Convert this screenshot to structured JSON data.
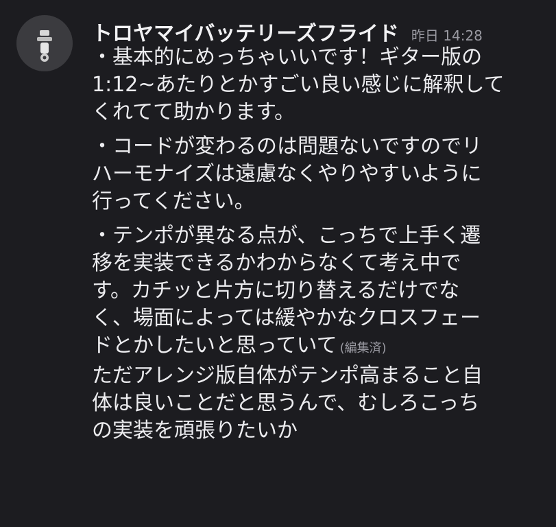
{
  "message": {
    "author": "トロヤマイバッテリーズフライド",
    "timestamp": "昨日 14:28",
    "edited_label": "(編集済)",
    "paragraphs": [
      {
        "lines": [
          "・基本的にめっちゃいいです！ギター版の",
          "1:12~あたりとかすごい良い感じに解釈して",
          "くれてて助かります。"
        ]
      },
      {
        "lines": [
          "・コードが変わるのは問題ないですのでリ",
          "ハーモナイズは遠慮なくやりやすいように",
          "行ってください。"
        ]
      },
      {
        "lines": [
          "・テンポが異なる点が、こっちで上手く遷",
          "移を実装できるかわからなくて考え中で",
          "す。カチッと片方に切り替えるだけでな",
          "く、場面によっては緩やかなクロスフェー",
          "ドとかしたいと思っていて"
        ]
      }
    ],
    "followup_lines": [
      "ただアレンジ版自体がテンポ高まること自",
      "体は良いことだと思うんで、むしろこっち",
      "の実装を頑張りたいか"
    ]
  }
}
